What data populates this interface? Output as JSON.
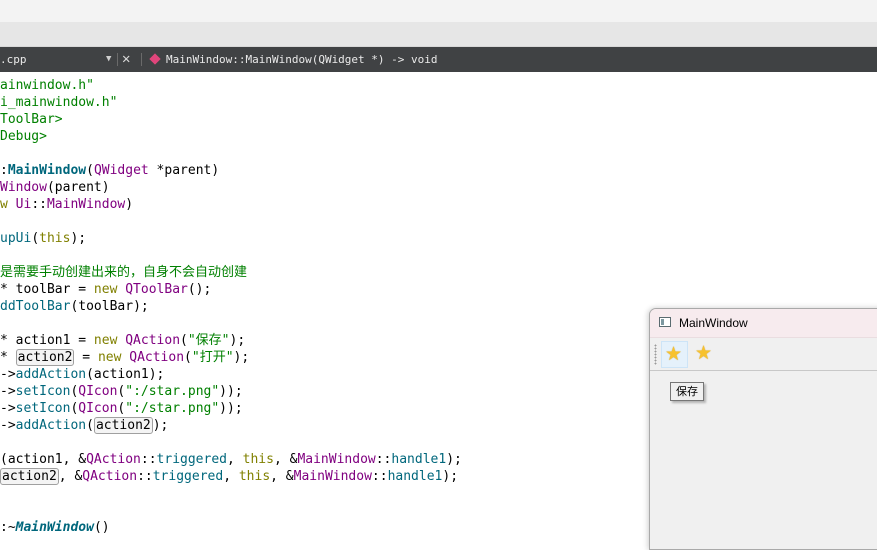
{
  "editor": {
    "tab": {
      "file_name": ".cpp",
      "dropdown_arrow": "▼",
      "close": "✕",
      "symbol": "MainWindow::MainWindow(QWidget *) -> void"
    },
    "code": {
      "l1": {
        "a": "ainwindow.h\""
      },
      "l2": {
        "a": "i_mainwindow.h\""
      },
      "l3": {
        "a": "ToolBar>"
      },
      "l4": {
        "a": "Debug>"
      },
      "l5": {
        "a": ":",
        "b": "MainWindow",
        "c": "(",
        "d": "QWidget",
        "e": " *parent)"
      },
      "l6": {
        "a": "Window",
        "b": "(parent)"
      },
      "l7": {
        "a": "w",
        "b": " ",
        "c": "Ui",
        "d": "::",
        "e": "MainWindow",
        "f": ")"
      },
      "l8": {
        "a": "upUi",
        "b": "(",
        "c": "this",
        "d": ");"
      },
      "l9": {
        "a": "是需要手动创建出来的，自身不会自动创建"
      },
      "l10": {
        "a": "* toolBar = ",
        "b": "new",
        "c": " ",
        "d": "QToolBar",
        "e": "();"
      },
      "l11": {
        "a": "ddToolBar",
        "b": "(toolBar);"
      },
      "l12": {
        "a": "* action1 = ",
        "b": "new",
        "c": " ",
        "d": "QAction",
        "e": "(",
        "f": "\"保存\"",
        "g": ");"
      },
      "l13": {
        "a": "* ",
        "b": "action2",
        "c": " = ",
        "d": "new",
        "e": " ",
        "f": "QAction",
        "g": "(",
        "h": "\"打开\"",
        "i": ");"
      },
      "l14": {
        "a": "->",
        "b": "addAction",
        "c": "(action1);"
      },
      "l15": {
        "a": "->",
        "b": "setIcon",
        "c": "(",
        "d": "QIcon",
        "e": "(",
        "f": "\":/star.png\"",
        "g": "));"
      },
      "l16": {
        "a": "->",
        "b": "setIcon",
        "c": "(",
        "d": "QIcon",
        "e": "(",
        "f": "\":/star.png\"",
        "g": "));"
      },
      "l17": {
        "a": "->",
        "b": "addAction",
        "c": "(",
        "d": "action2",
        "e": ");"
      },
      "l18": {
        "a": "(action1, &",
        "b": "QAction",
        "c": "::",
        "d": "triggered",
        "e": ", ",
        "f": "this",
        "g": ", &",
        "h": "MainWindow",
        "i": "::",
        "j": "handle1",
        "k": ");"
      },
      "l19": {
        "a": "action2",
        "b": ", &",
        "c": "QAction",
        "d": "::",
        "e": "triggered",
        "f": ", ",
        "g": "this",
        "h": ", &",
        "i": "MainWindow",
        "j": "::",
        "k": "handle1",
        "l": ");"
      },
      "l20": {
        "a": ":~",
        "b": "MainWindow",
        "c": "()"
      }
    }
  },
  "app_window": {
    "title": "MainWindow",
    "toolbar": [
      {
        "icon": "star-icon",
        "glyph": "★",
        "active": true
      },
      {
        "icon": "star-icon",
        "glyph": "★",
        "active": false
      }
    ],
    "tooltip": "保存"
  },
  "colors": {
    "string": "#008000",
    "keyword": "#808000",
    "type": "#800080",
    "function": "#00677c",
    "tab_bar": "#404244"
  }
}
